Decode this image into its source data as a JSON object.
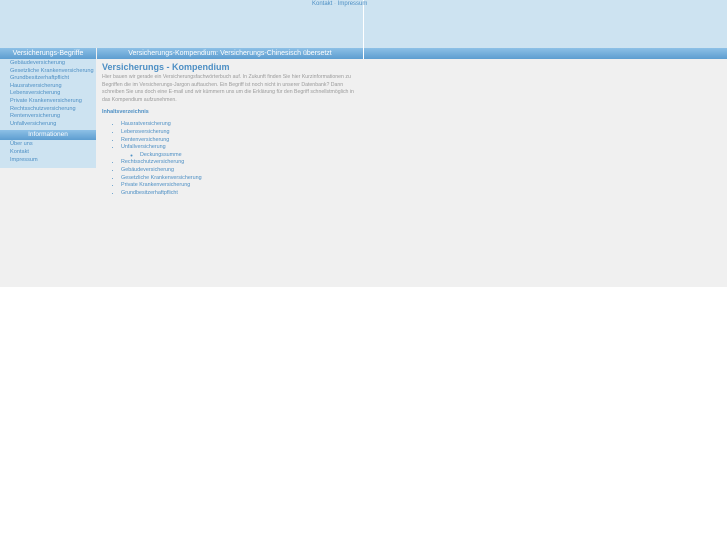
{
  "header": {
    "toplinks": [
      "Kontakt",
      "Impressum"
    ],
    "separator": "·"
  },
  "bars": {
    "left": "Versicherungs-Begriffe",
    "main": "Versicherungs-Kompendium: Versicherungs-Chinesisch übersetzt"
  },
  "sidebar": {
    "items": [
      "Gebäudeversicherung",
      "Gesetzliche Krankenversicherung",
      "Grundbesitzerhaftpflicht",
      "Hausratversicherung",
      "Lebensversicherung",
      "Private Krankenversicherung",
      "Rechtsschutzversicherung",
      "Rentenversicherung",
      "Unfallversicherung"
    ],
    "info_heading": "Informationen",
    "info_items": [
      "Über uns",
      "Kontakt",
      "Impressum"
    ]
  },
  "main": {
    "title": "Versicherungs - Kompendium",
    "intro": "Hier bauen wir gerade ein Versicherungsfachwörterbuch auf. In Zukunft finden Sie hier Kurzinformationen zu Begriffen die im Versicherungs-Jargon auftauchen. Ein Begriff ist noch nicht in unserer Datenbank? Dann schreiben Sie uns doch eine E-mail und wir kümmern uns um die Erklärung für den Begriff schnellstmöglich in das Kompendium aufzunehmen.",
    "toc_heading": "Inhaltsverzeichnis",
    "toc": [
      "Hausratversicherung",
      "Lebensversicherung",
      "Rentenversicherung",
      "Unfallversicherung"
    ],
    "toc_sub": [
      "Deckungssumme"
    ],
    "toc_rest": [
      "Rechtsschutzversicherung",
      "Gebäudeversicherung",
      "Gesetzliche Krankenversicherung",
      "Private Krankenversicherung",
      "Grundbesitzerhaftpflicht"
    ]
  },
  "colors": {
    "accent": "#4d8fc4",
    "header_bg": "#cde3f1",
    "bar_top": "#8dc0e6",
    "bar_bottom": "#5d9dd0",
    "page_bg": "#f0f0f0"
  }
}
